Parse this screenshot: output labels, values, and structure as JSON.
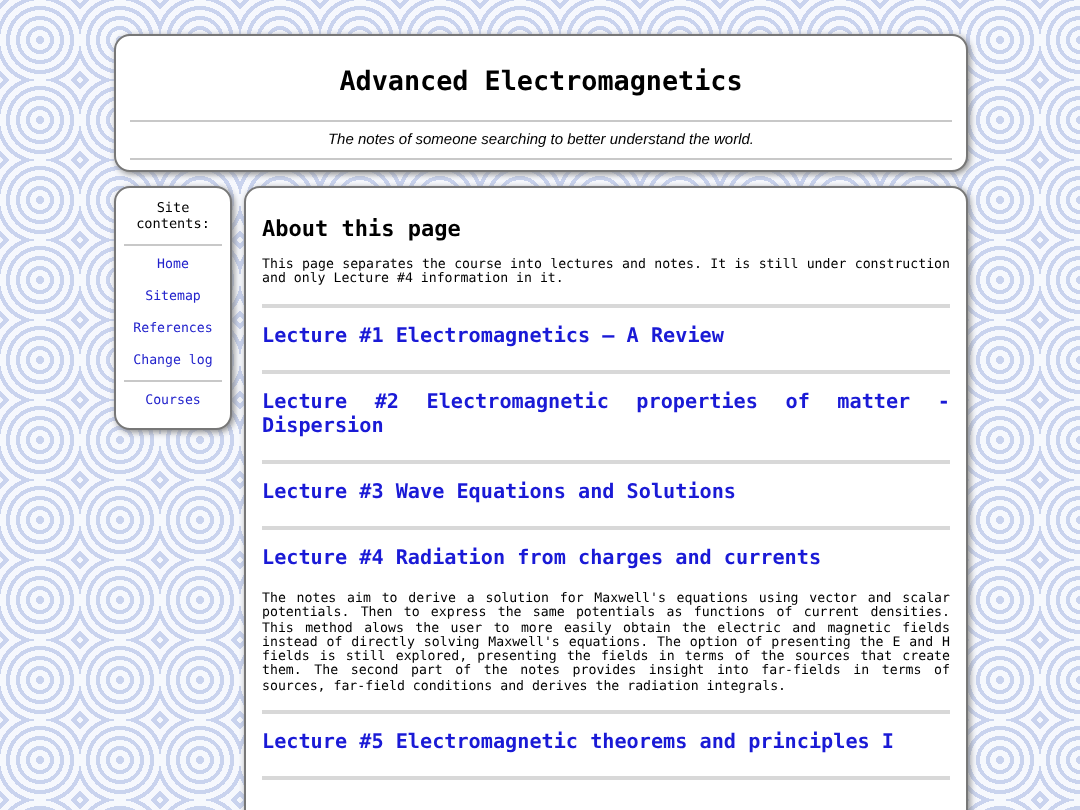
{
  "header": {
    "title": "Advanced Electromagnetics",
    "subtitle": "The notes of someone searching to better understand the world."
  },
  "sidebar": {
    "heading": "Site contents:",
    "links": [
      "Home",
      "Sitemap",
      "References",
      "Change log"
    ],
    "extra_links": [
      "Courses"
    ]
  },
  "about": {
    "heading": "About this page",
    "text": "This page separates the course into lectures and notes. It is still under construction and only Lecture #4 information in it."
  },
  "lectures": [
    {
      "title": "Lecture #1 Electromagnetics – A Review"
    },
    {
      "title": "Lecture #2 Electromagnetic properties of matter - Dispersion"
    },
    {
      "title": "Lecture #3 Wave Equations and Solutions"
    },
    {
      "title": "Lecture #4 Radiation from charges and currents",
      "description": "The notes aim to derive a solution for Maxwell's equations using vector and scalar potentials. Then to express the same potentials as functions of current densities. This method alows the user to more easily obtain the electric and magnetic fields instead of directly solving Maxwell's equations. The option of presenting the E and H fields is still explored, presenting the fields in terms of the sources that create them. The second part of the notes provides insight into far-fields in terms of sources, far-field conditions and derives the radiation integrals."
    },
    {
      "title": "Lecture #5 Electromagnetic theorems and principles I"
    }
  ]
}
